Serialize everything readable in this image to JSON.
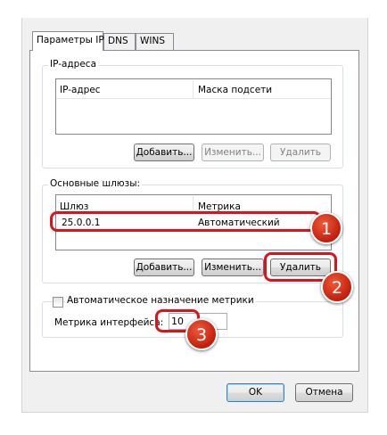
{
  "tabs": [
    "Параметры IP",
    "DNS",
    "WINS"
  ],
  "ip_group": {
    "title": "IP-адреса",
    "columns": [
      "IP-адрес",
      "Маска подсети"
    ],
    "buttons": {
      "add": "Добавить...",
      "edit": "Изменить...",
      "delete": "Удалить"
    }
  },
  "gateway_group": {
    "title": "Основные шлюзы:",
    "columns": [
      "Шлюз",
      "Метрика"
    ],
    "rows": [
      {
        "gateway": "25.0.0.1",
        "metric": "Автоматический"
      }
    ],
    "buttons": {
      "add": "Добавить...",
      "edit": "Изменить...",
      "delete": "Удалить"
    }
  },
  "auto_metric": {
    "label": "Автоматическое назначение метрики",
    "checked": false
  },
  "interface_metric": {
    "label": "Метрика интерфейса:",
    "value": "10"
  },
  "dialog_buttons": {
    "ok": "OK",
    "cancel": "Отмена"
  },
  "annotations": [
    "1",
    "2",
    "3"
  ],
  "colors": {
    "highlight": "#d9151b",
    "badge": "#c21e0b"
  }
}
